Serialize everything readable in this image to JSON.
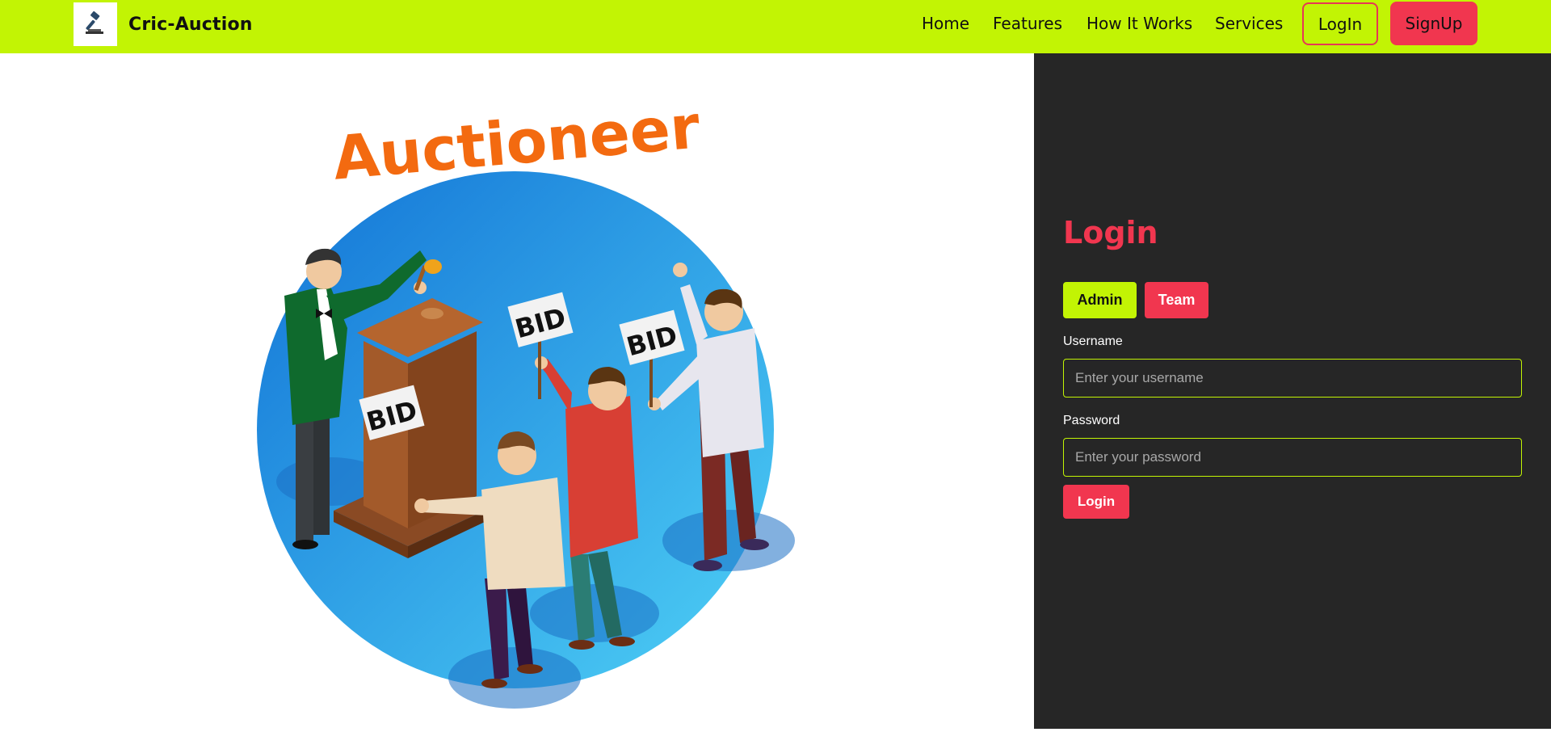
{
  "navbar": {
    "brand_name": "Cric-Auction",
    "logo_icon": "gavel-icon",
    "links": [
      "Home",
      "Features",
      "How It Works",
      "Services"
    ],
    "login_label": "LogIn",
    "signup_label": "SignUp"
  },
  "hero": {
    "banner_text": "Auctioneer",
    "sign_text": "BID"
  },
  "login": {
    "title": "Login",
    "roles": [
      "Admin",
      "Team"
    ],
    "username_label": "Username",
    "username_placeholder": "Enter your username",
    "password_label": "Password",
    "password_placeholder": "Enter your password",
    "submit_label": "Login"
  },
  "colors": {
    "accent_green": "#c2f404",
    "accent_red": "#f1364f",
    "panel_bg": "#262626"
  }
}
